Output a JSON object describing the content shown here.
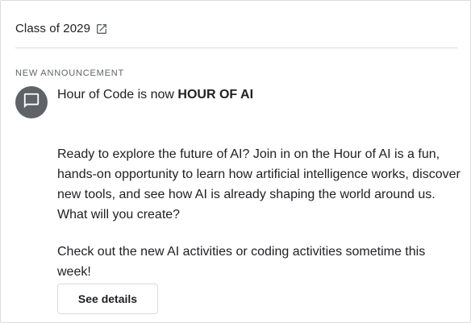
{
  "header": {
    "class_title": "Class of 2029",
    "open_icon": "open-in-new-icon"
  },
  "announcement": {
    "eyebrow": "NEW ANNOUNCEMENT",
    "avatar_icon": "announcement-icon",
    "title_prefix": "Hour of Code is now ",
    "title_bold": "HOUR OF AI",
    "paragraph_1": "Ready to explore the future of AI? Join in on the Hour of AI is a fun, hands-on opportunity to learn how artificial intelligence works, discover new tools, and see how AI is already shaping the world around us.  What will you create?",
    "paragraph_2": "Check out the new AI activities or coding activities sometime this week!",
    "details_label": "See details"
  },
  "colors": {
    "avatar_bg": "#5f6368",
    "border": "#dadce0",
    "text": "#202124",
    "muted": "#5f6368"
  }
}
